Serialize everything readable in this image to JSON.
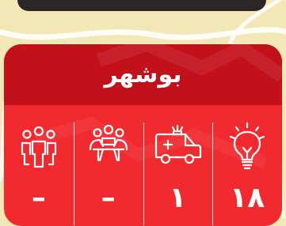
{
  "card": {
    "title": "بوشهر",
    "stats": [
      {
        "icon": "lightbulb-icon",
        "value": "۱۸"
      },
      {
        "icon": "ambulance-icon",
        "value": "۱"
      },
      {
        "icon": "meeting-group-icon",
        "value": "–"
      },
      {
        "icon": "people-group-icon",
        "value": "–"
      }
    ]
  },
  "colors": {
    "header": "#c3111b",
    "body": "#f02a2e",
    "map_bg": "#f3e6b7",
    "text": "#ffffff"
  }
}
